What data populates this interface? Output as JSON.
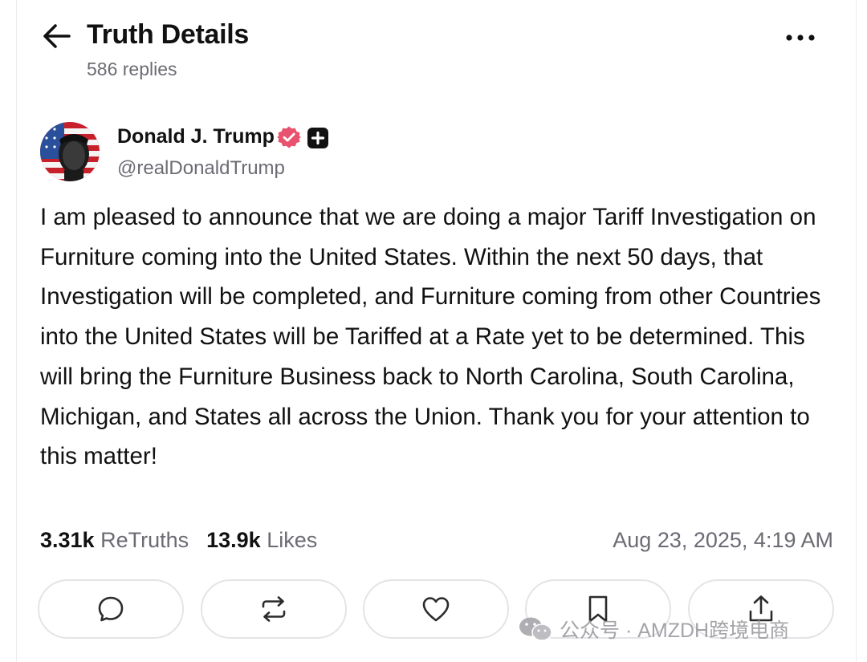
{
  "header": {
    "title": "Truth Details",
    "replies": "586 replies"
  },
  "post": {
    "author": {
      "name": "Donald J. Trump",
      "handle": "@realDonaldTrump"
    },
    "text": "I am pleased to announce that we are doing a major Tariff Investigation on Furniture coming into the United States. Within the next 50 days, that Investigation will be completed, and Furniture coming from other Countries into the United States will be Tariffed at a Rate yet to be determined. This will bring the Furniture Business back to North Carolina, South Carolina, Michigan, and States all across the Union. Thank you for your attention to this matter!",
    "stats": {
      "retruths_count": "3.31k",
      "retruths_label": "ReTruths",
      "likes_count": "13.9k",
      "likes_label": "Likes"
    },
    "timestamp": "Aug 23, 2025, 4:19 AM"
  },
  "actions": [
    {
      "name": "reply",
      "icon": "comment-icon"
    },
    {
      "name": "retruth",
      "icon": "repost-icon"
    },
    {
      "name": "like",
      "icon": "heart-icon"
    },
    {
      "name": "bookmark",
      "icon": "bookmark-icon"
    },
    {
      "name": "share",
      "icon": "share-icon"
    }
  ],
  "watermark": {
    "text": "公众号 · AMZDH跨境电商"
  },
  "colors": {
    "text": "#111111",
    "muted": "#6b6b73",
    "verified": "#e8526e",
    "border": "#e4e4e8"
  }
}
